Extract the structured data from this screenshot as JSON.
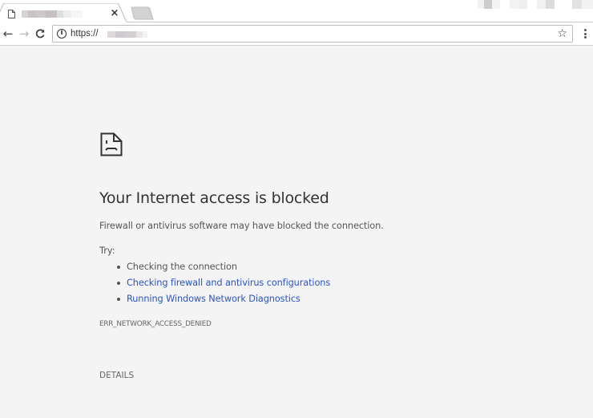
{
  "browser": {
    "tab": {
      "title_redacted": true,
      "close_glyph": "×",
      "favicon": "page-icon"
    },
    "new_tab_icon": "new-tab-icon",
    "toolbar": {
      "back_glyph": "←",
      "forward_glyph": "→",
      "reload_glyph": "C",
      "info_glyph": "i",
      "url_prefix": "https://",
      "url_redacted": true,
      "bookmark_glyph": "☆",
      "menu_icon": "kebab-menu-icon"
    }
  },
  "page": {
    "icon": "sad-page-icon",
    "heading": "Your Internet access is blocked",
    "message": "Firewall or antivirus software may have blocked the connection.",
    "try_label": "Try:",
    "suggestions": [
      {
        "text": "Checking the connection",
        "link": false
      },
      {
        "text": "Checking firewall and antivirus configurations",
        "link": true
      },
      {
        "text": "Running Windows Network Diagnostics",
        "link": true
      }
    ],
    "error_code": "ERR_NETWORK_ACCESS_DENIED",
    "details_label": "DETAILS"
  },
  "colors": {
    "background": "#f4f4f4",
    "link": "#2a54c8",
    "text": "#555555",
    "heading": "#333333"
  }
}
